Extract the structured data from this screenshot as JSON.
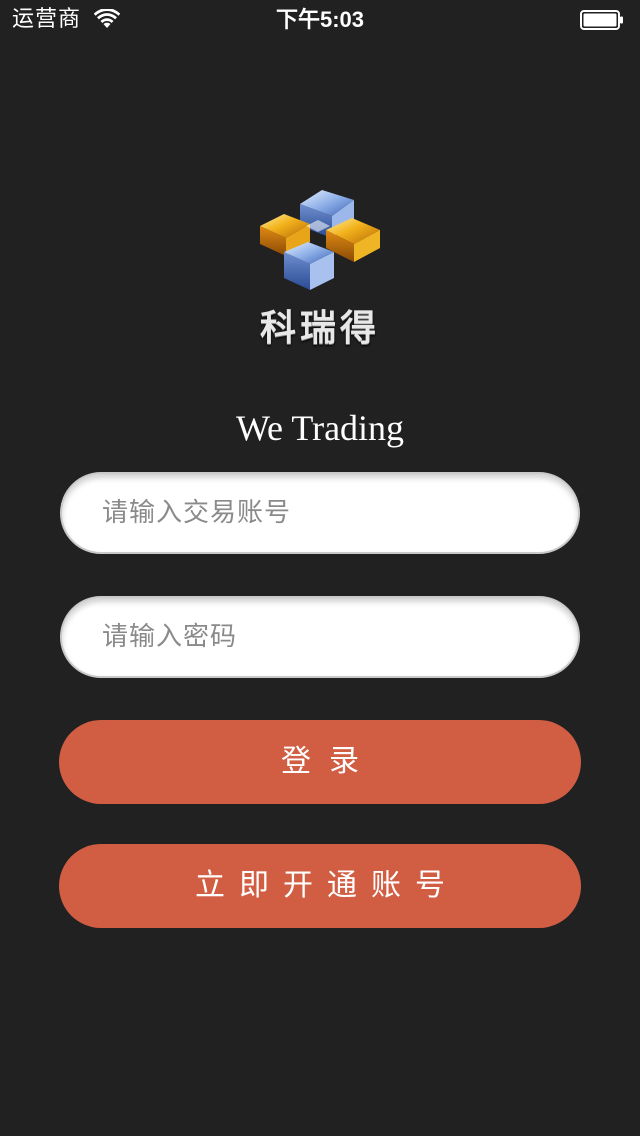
{
  "status_bar": {
    "carrier": "运营商",
    "time": "下午5:03",
    "wifi_icon": "wifi-icon",
    "battery_icon": "battery-icon"
  },
  "brand": {
    "logo_icon": "keruide-logo-icon",
    "name": "科瑞得",
    "tagline": "We Trading"
  },
  "form": {
    "account_placeholder": "请输入交易账号",
    "account_value": "",
    "password_placeholder": "请输入密码",
    "password_value": "",
    "login_label": "登录",
    "open_account_label": "立即开通账号"
  },
  "colors": {
    "background": "#212121",
    "button": "#d15d43",
    "input_bg": "#ffffff",
    "text": "#ffffff"
  }
}
